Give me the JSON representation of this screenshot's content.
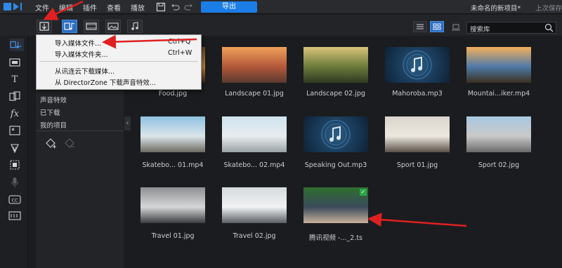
{
  "menubar": {
    "items": [
      "文件",
      "编辑",
      "插件",
      "查看",
      "播放"
    ],
    "export_label": "导出",
    "project_title": "未命名的新项目*",
    "project_status": "上次保存"
  },
  "search": {
    "placeholder": "搜索库"
  },
  "nav": {
    "items": [
      "声音特效",
      "已下载",
      "我的项目"
    ]
  },
  "dropdown": {
    "items": [
      {
        "label": "导入媒体文件...",
        "shortcut": "Ctrl+Q"
      },
      {
        "label": "导入媒体文件夹...",
        "shortcut": "Ctrl+W"
      },
      {
        "label": "从讯连云下载媒体...",
        "shortcut": ""
      },
      {
        "label": "从 DirectorZone 下载声音特效...",
        "shortcut": ""
      }
    ]
  },
  "media": [
    {
      "label": "Food.jpg",
      "kind": "image",
      "colors": [
        "#6b4a2a",
        "#c98a43",
        "#3a2618"
      ]
    },
    {
      "label": "Landscape 01.jpg",
      "kind": "image",
      "colors": [
        "#f0a15a",
        "#b3583a",
        "#5a3a30"
      ]
    },
    {
      "label": "Landscape 02.jpg",
      "kind": "image",
      "colors": [
        "#d8c37a",
        "#6c7a3a",
        "#2f3a22"
      ]
    },
    {
      "label": "Mahoroba.mp3",
      "kind": "audio",
      "colors": [
        "#0e2236",
        "#1c3f5f",
        "#2d5f86"
      ]
    },
    {
      "label": "Mountai...iker.mp4",
      "kind": "image",
      "colors": [
        "#f3b05d",
        "#4f7aa8",
        "#3b3020"
      ]
    },
    {
      "label": "Skatebo... 01.mp4",
      "kind": "image",
      "colors": [
        "#8fc0e0",
        "#dbe6ea",
        "#6d6a60"
      ]
    },
    {
      "label": "Skatebo... 02.mp4",
      "kind": "image",
      "colors": [
        "#cfe3ef",
        "#e8ecef",
        "#9aa2a6"
      ]
    },
    {
      "label": "Speaking Out.mp3",
      "kind": "audio",
      "colors": [
        "#0e2236",
        "#1c3f5f",
        "#2d5f86"
      ]
    },
    {
      "label": "Sport 01.jpg",
      "kind": "image",
      "colors": [
        "#d9d4cc",
        "#ece8e0",
        "#5a5048"
      ]
    },
    {
      "label": "Sport 02.jpg",
      "kind": "image",
      "colors": [
        "#a8c8e0",
        "#c9c9c9",
        "#6a6a6a"
      ]
    },
    {
      "label": "Travel 01.jpg",
      "kind": "image",
      "colors": [
        "#8d8f92",
        "#d5d7d8",
        "#3a3c40"
      ]
    },
    {
      "label": "Travel 02.jpg",
      "kind": "image",
      "colors": [
        "#d6dadd",
        "#f0f2f3",
        "#5a5f64"
      ]
    },
    {
      "label": "腾讯视频 -..._2.ts",
      "kind": "video",
      "colors": [
        "#2f6e2f",
        "#3a4a5a",
        "#c8b09a"
      ],
      "checked": true
    }
  ],
  "colors": {
    "accent": "#1b7de6",
    "arrow": "#e02020",
    "background": "#1b1c1f"
  }
}
